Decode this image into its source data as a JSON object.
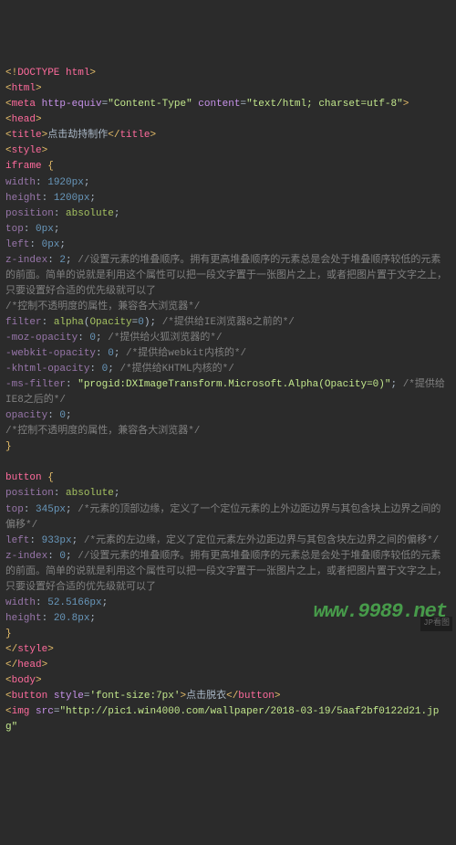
{
  "lines": [
    [
      {
        "c": "tag-bracket",
        "t": "<!"
      },
      {
        "c": "tag-name",
        "t": "DOCTYPE html"
      },
      {
        "c": "tag-bracket",
        "t": ">"
      }
    ],
    [
      {
        "c": "tag-bracket",
        "t": "<"
      },
      {
        "c": "tag-name",
        "t": "html"
      },
      {
        "c": "tag-bracket",
        "t": ">"
      }
    ],
    [
      {
        "c": "tag-bracket",
        "t": "<"
      },
      {
        "c": "tag-name",
        "t": "meta "
      },
      {
        "c": "attr-name",
        "t": "http-equiv"
      },
      {
        "c": "text",
        "t": "="
      },
      {
        "c": "attr-val",
        "t": "\"Content-Type\""
      },
      {
        "c": "text",
        "t": " "
      },
      {
        "c": "attr-name",
        "t": "content"
      },
      {
        "c": "text",
        "t": "="
      },
      {
        "c": "attr-val",
        "t": "\"text/html; charset=utf-8\""
      },
      {
        "c": "tag-bracket",
        "t": ">"
      }
    ],
    [
      {
        "c": "tag-bracket",
        "t": "<"
      },
      {
        "c": "tag-name",
        "t": "head"
      },
      {
        "c": "tag-bracket",
        "t": ">"
      }
    ],
    [
      {
        "c": "tag-bracket",
        "t": "<"
      },
      {
        "c": "tag-name",
        "t": "title"
      },
      {
        "c": "tag-bracket",
        "t": ">"
      },
      {
        "c": "text",
        "t": "点击劫持制作"
      },
      {
        "c": "tag-bracket",
        "t": "</"
      },
      {
        "c": "tag-name",
        "t": "title"
      },
      {
        "c": "tag-bracket",
        "t": ">"
      }
    ],
    [
      {
        "c": "tag-bracket",
        "t": "<"
      },
      {
        "c": "tag-name",
        "t": "style"
      },
      {
        "c": "tag-bracket",
        "t": ">"
      }
    ],
    [
      {
        "c": "tag-name",
        "t": "iframe "
      },
      {
        "c": "brace",
        "t": "{"
      }
    ],
    [
      {
        "c": "prop",
        "t": "width"
      },
      {
        "c": "semi",
        "t": ": "
      },
      {
        "c": "num",
        "t": "1920px"
      },
      {
        "c": "semi",
        "t": ";"
      }
    ],
    [
      {
        "c": "prop",
        "t": "height"
      },
      {
        "c": "semi",
        "t": ": "
      },
      {
        "c": "num",
        "t": "1200px"
      },
      {
        "c": "semi",
        "t": ";"
      }
    ],
    [
      {
        "c": "prop",
        "t": "position"
      },
      {
        "c": "semi",
        "t": ": "
      },
      {
        "c": "val",
        "t": "absolute"
      },
      {
        "c": "semi",
        "t": ";"
      }
    ],
    [
      {
        "c": "prop",
        "t": "top"
      },
      {
        "c": "semi",
        "t": ": "
      },
      {
        "c": "num",
        "t": "0px"
      },
      {
        "c": "semi",
        "t": ";"
      }
    ],
    [
      {
        "c": "prop",
        "t": "left"
      },
      {
        "c": "semi",
        "t": ": "
      },
      {
        "c": "num",
        "t": "0px"
      },
      {
        "c": "semi",
        "t": ";"
      }
    ],
    [
      {
        "c": "prop",
        "t": "z-index"
      },
      {
        "c": "semi",
        "t": ": "
      },
      {
        "c": "num",
        "t": "2"
      },
      {
        "c": "semi",
        "t": "; "
      },
      {
        "c": "comment",
        "t": "//设置元素的堆叠顺序。拥有更高堆叠顺序的元素总是会处于堆叠顺序较低的元素的前面。简单的说就是利用这个属性可以把一段文字置于一张图片之上，或者把图片置于文字之上，只要设置好合适的优先级就可以了"
      }
    ],
    [
      {
        "c": "comment",
        "t": "/*控制不透明度的属性，兼容各大浏览器*/"
      }
    ],
    [
      {
        "c": "prop",
        "t": "filter"
      },
      {
        "c": "semi",
        "t": ": "
      },
      {
        "c": "val",
        "t": "alpha"
      },
      {
        "c": "semi",
        "t": "("
      },
      {
        "c": "val",
        "t": "Opacity"
      },
      {
        "c": "semi",
        "t": "="
      },
      {
        "c": "num",
        "t": "0"
      },
      {
        "c": "semi",
        "t": "); "
      },
      {
        "c": "comment",
        "t": "/*提供给IE浏览器8之前的*/"
      }
    ],
    [
      {
        "c": "prop",
        "t": "-moz-opacity"
      },
      {
        "c": "semi",
        "t": ": "
      },
      {
        "c": "num",
        "t": "0"
      },
      {
        "c": "semi",
        "t": "; "
      },
      {
        "c": "comment",
        "t": "/*提供给火狐浏览器的*/"
      }
    ],
    [
      {
        "c": "prop",
        "t": "-webkit-opacity"
      },
      {
        "c": "semi",
        "t": ": "
      },
      {
        "c": "num",
        "t": "0"
      },
      {
        "c": "semi",
        "t": "; "
      },
      {
        "c": "comment",
        "t": "/*提供给webkit内核的*/"
      }
    ],
    [
      {
        "c": "prop",
        "t": "-khtml-opacity"
      },
      {
        "c": "semi",
        "t": ": "
      },
      {
        "c": "num",
        "t": "0"
      },
      {
        "c": "semi",
        "t": "; "
      },
      {
        "c": "comment",
        "t": "/*提供给KHTML内核的*/"
      }
    ],
    [
      {
        "c": "prop",
        "t": "-ms-filter"
      },
      {
        "c": "semi",
        "t": ": "
      },
      {
        "c": "str",
        "t": "\"progid:DXImageTransform.Microsoft.Alpha(Opacity=0)\""
      },
      {
        "c": "semi",
        "t": "; "
      },
      {
        "c": "comment",
        "t": "/*提供给IE8之后的*/"
      }
    ],
    [
      {
        "c": "prop",
        "t": "opacity"
      },
      {
        "c": "semi",
        "t": ": "
      },
      {
        "c": "num",
        "t": "0"
      },
      {
        "c": "semi",
        "t": ";"
      }
    ],
    [
      {
        "c": "comment",
        "t": "/*控制不透明度的属性，兼容各大浏览器*/"
      }
    ],
    [
      {
        "c": "brace",
        "t": "}"
      }
    ],
    [
      {
        "c": "text",
        "t": ""
      }
    ],
    [
      {
        "c": "tag-name",
        "t": "button "
      },
      {
        "c": "brace",
        "t": "{"
      }
    ],
    [
      {
        "c": "prop",
        "t": "position"
      },
      {
        "c": "semi",
        "t": ": "
      },
      {
        "c": "val",
        "t": "absolute"
      },
      {
        "c": "semi",
        "t": ";"
      }
    ],
    [
      {
        "c": "prop",
        "t": "top"
      },
      {
        "c": "semi",
        "t": ": "
      },
      {
        "c": "num",
        "t": "345px"
      },
      {
        "c": "semi",
        "t": "; "
      },
      {
        "c": "comment",
        "t": "/*元素的顶部边缘，定义了一个定位元素的上外边距边界与其包含块上边界之间的偏移*/"
      }
    ],
    [
      {
        "c": "prop",
        "t": "left"
      },
      {
        "c": "semi",
        "t": ": "
      },
      {
        "c": "num",
        "t": "933px"
      },
      {
        "c": "semi",
        "t": "; "
      },
      {
        "c": "comment",
        "t": "/*元素的左边缘，定义了定位元素左外边距边界与其包含块左边界之间的偏移*/"
      }
    ],
    [
      {
        "c": "prop",
        "t": "z-index"
      },
      {
        "c": "semi",
        "t": ": "
      },
      {
        "c": "num",
        "t": "0"
      },
      {
        "c": "semi",
        "t": "; "
      },
      {
        "c": "comment",
        "t": "//设置元素的堆叠顺序。拥有更高堆叠顺序的元素总是会处于堆叠顺序较低的元素的前面。简单的说就是利用这个属性可以把一段文字置于一张图片之上，或者把图片置于文字之上，只要设置好合适的优先级就可以了"
      }
    ],
    [
      {
        "c": "prop",
        "t": "width"
      },
      {
        "c": "semi",
        "t": ": "
      },
      {
        "c": "num",
        "t": "52.5166px"
      },
      {
        "c": "semi",
        "t": ";"
      }
    ],
    [
      {
        "c": "prop",
        "t": "height"
      },
      {
        "c": "semi",
        "t": ": "
      },
      {
        "c": "num",
        "t": "20.8px"
      },
      {
        "c": "semi",
        "t": ";"
      }
    ],
    [
      {
        "c": "brace",
        "t": "}"
      }
    ],
    [
      {
        "c": "tag-bracket",
        "t": "</"
      },
      {
        "c": "tag-name",
        "t": "style"
      },
      {
        "c": "tag-bracket",
        "t": ">"
      }
    ],
    [
      {
        "c": "tag-bracket",
        "t": "</"
      },
      {
        "c": "tag-name",
        "t": "head"
      },
      {
        "c": "tag-bracket",
        "t": ">"
      }
    ],
    [
      {
        "c": "tag-bracket",
        "t": "<"
      },
      {
        "c": "tag-name",
        "t": "body"
      },
      {
        "c": "tag-bracket",
        "t": ">"
      }
    ],
    [
      {
        "c": "tag-bracket",
        "t": "<"
      },
      {
        "c": "tag-name",
        "t": "button "
      },
      {
        "c": "attr-name",
        "t": "style"
      },
      {
        "c": "text",
        "t": "="
      },
      {
        "c": "attr-val",
        "t": "'font-size:7px'"
      },
      {
        "c": "tag-bracket",
        "t": ">"
      },
      {
        "c": "text",
        "t": "点击脱衣"
      },
      {
        "c": "tag-bracket",
        "t": "</"
      },
      {
        "c": "tag-name",
        "t": "button"
      },
      {
        "c": "tag-bracket",
        "t": ">"
      }
    ],
    [
      {
        "c": "tag-bracket",
        "t": "<"
      },
      {
        "c": "tag-name",
        "t": "img "
      },
      {
        "c": "attr-name",
        "t": "src"
      },
      {
        "c": "text",
        "t": "="
      },
      {
        "c": "attr-val",
        "t": "\"http://pic1.win4000.com/wallpaper/2018-03-19/5aaf2bf0122d21.jpg\""
      }
    ]
  ],
  "watermark": "www.9989.net",
  "corner": "JP看图"
}
